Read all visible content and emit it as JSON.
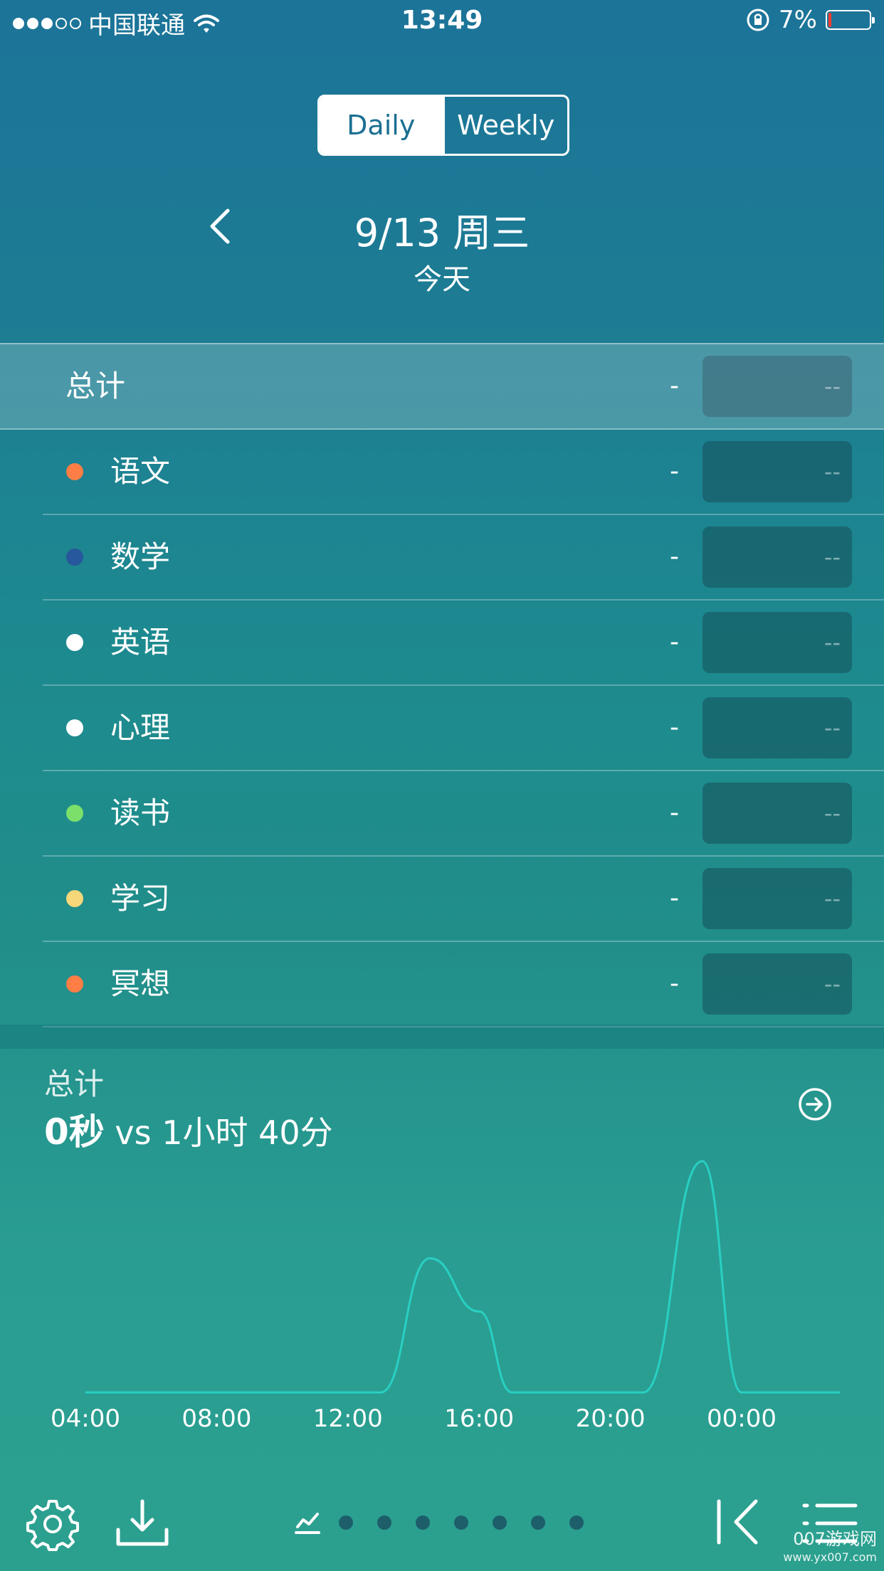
{
  "status_bar": {
    "carrier": "中国联通",
    "time": "13:49",
    "battery_percent": "7%",
    "battery_level": 0.07,
    "signal_bars": 3,
    "icons": [
      "wifi-icon",
      "rotation-lock-icon",
      "battery-icon"
    ]
  },
  "segment": {
    "daily": "Daily",
    "weekly": "Weekly",
    "selected": "Daily"
  },
  "date": {
    "title": "9/13 周三",
    "subtitle": "今天"
  },
  "list": {
    "total": {
      "label": "总计",
      "dash": "-",
      "value": "--"
    },
    "items": [
      {
        "label": "语文",
        "color": "#ff7e45",
        "dash": "-",
        "value": "--"
      },
      {
        "label": "数学",
        "color": "#27579c",
        "dash": "-",
        "value": "--"
      },
      {
        "label": "英语",
        "color": "#ffffff",
        "dash": "-",
        "value": "--"
      },
      {
        "label": "心理",
        "color": "#ffffff",
        "dash": "-",
        "value": "--"
      },
      {
        "label": "读书",
        "color": "#7be06a",
        "dash": "-",
        "value": "--"
      },
      {
        "label": "学习",
        "color": "#f6d77a",
        "dash": "-",
        "value": "--"
      },
      {
        "label": "冥想",
        "color": "#ff7e45",
        "dash": "-",
        "value": "--"
      }
    ]
  },
  "summary": {
    "label": "总计",
    "current": "0秒",
    "vs_text": "vs 1小时 40分"
  },
  "chart_data": {
    "type": "line",
    "x_ticks": [
      "04:00",
      "08:00",
      "12:00",
      "16:00",
      "20:00",
      "00:00"
    ],
    "line_color": "#28d0c3",
    "series": [
      {
        "x": [
          4,
          12,
          13,
          14.5,
          16,
          17,
          18,
          20,
          21,
          22.8,
          24,
          27
        ],
        "y": [
          0,
          0,
          0,
          0.58,
          0.35,
          0,
          0,
          0,
          0,
          1.0,
          0,
          0
        ]
      }
    ],
    "ylim": [
      0,
      1
    ],
    "grid": false
  },
  "toolbar": {
    "icons": [
      "gear-icon",
      "download-icon",
      "chart-icon",
      "first-page-icon",
      "list-icon"
    ],
    "page_dots": 7
  },
  "watermark": {
    "main": "007游戏网",
    "url": "www.yx007.com"
  }
}
